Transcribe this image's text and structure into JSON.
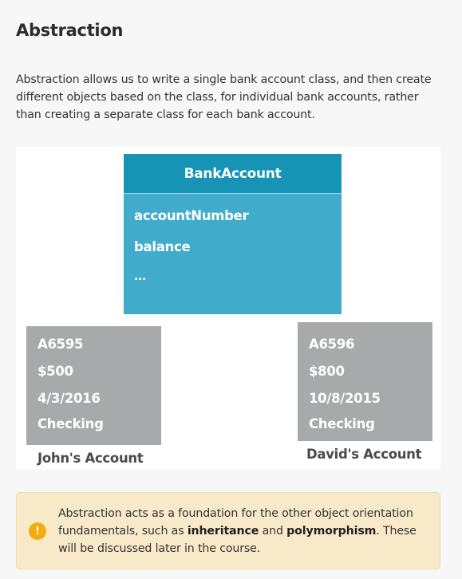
{
  "heading": "Abstraction",
  "intro": "Abstraction allows us to write a single bank account class, and then create different objects based on the class, for individual bank accounts, rather than creating a separate class for each bank account.",
  "diagram": {
    "class_name": "BankAccount",
    "fields": [
      "accountNumber",
      "balance",
      "..."
    ],
    "objects": [
      {
        "account_number": "A6595",
        "balance": "$500",
        "date": "4/3/2016",
        "type": "Checking",
        "caption": "John's Account"
      },
      {
        "account_number": "A6596",
        "balance": "$800",
        "date": "10/8/2015",
        "type": "Checking",
        "caption": "David's Account"
      }
    ],
    "colors": {
      "class_header": "#1793b6",
      "class_body": "#41abcc",
      "object_box": "#a7a9aa"
    }
  },
  "note": {
    "icon": "warning-icon",
    "text_before": "Abstraction acts as a foundation for the other object orientation fundamentals, such as ",
    "term1": "inheritance",
    "text_middle": " and ",
    "term2": "polymorphism",
    "text_after": ". These will be discussed later in the course.",
    "colors": {
      "background": "#f8eac9",
      "icon": "#f2ac0d"
    }
  }
}
